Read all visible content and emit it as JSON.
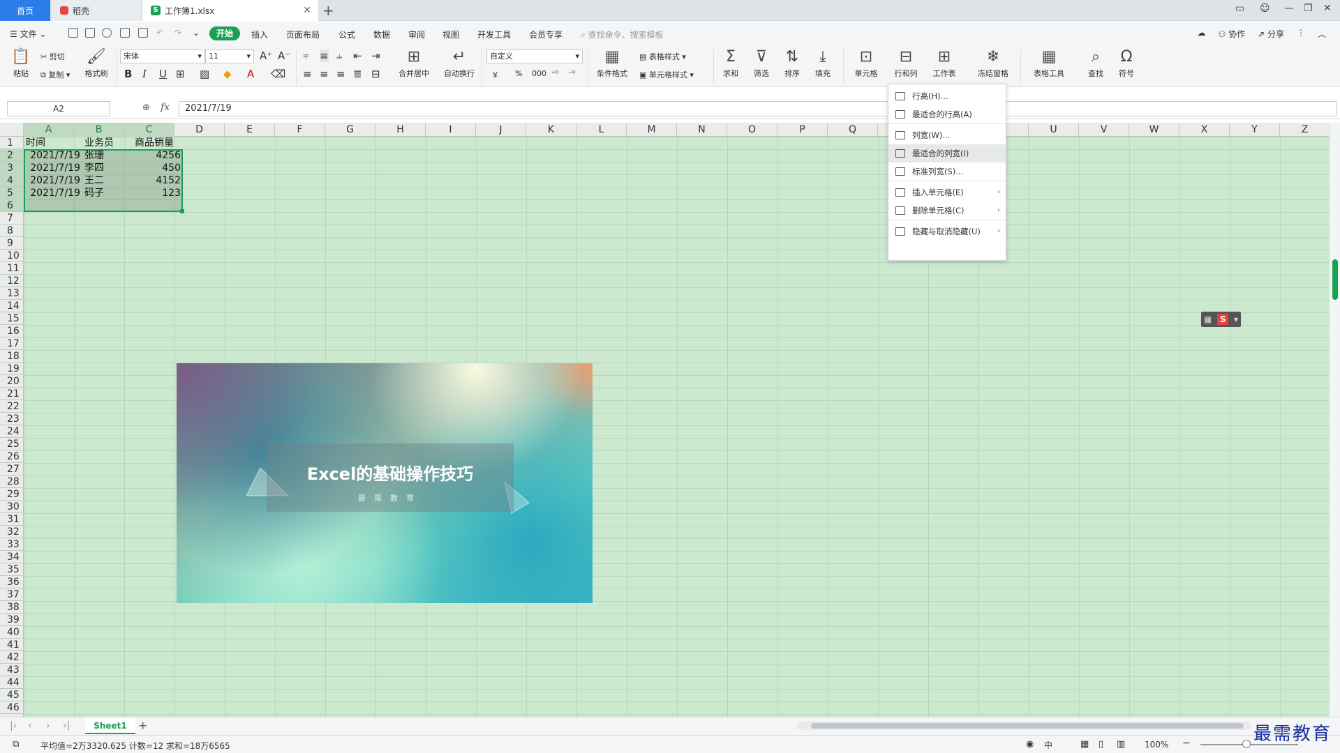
{
  "tabs": {
    "home": "首页",
    "daoke": "稻壳",
    "file": "工作簿1.xlsx"
  },
  "menubar": {
    "file": "文件",
    "start": "开始",
    "tabs": [
      "插入",
      "页面布局",
      "公式",
      "数据",
      "审阅",
      "视图",
      "开发工具",
      "会员专享"
    ],
    "search_placeholder": "查找命令、搜索模板",
    "collab": "协作",
    "share": "分享"
  },
  "ribbon": {
    "paste": "粘贴",
    "cut": "剪切",
    "copy": "复制",
    "format_painter": "格式刷",
    "font_name": "宋体",
    "font_size": "11",
    "bold": "B",
    "italic": "I",
    "underline": "U",
    "merge": "合并居中",
    "wrap": "自动换行",
    "number_format": "自定义",
    "currency": "￥",
    "percent": "%",
    "thousands": "000",
    "cond_format": "条件格式",
    "table_style": "表格样式",
    "cell_style": "单元格样式",
    "sum": "求和",
    "filter": "筛选",
    "sort": "排序",
    "fill": "填充",
    "cell": "单元格",
    "rowcol": "行和列",
    "worksheet": "工作表",
    "freeze": "冻结窗格",
    "table_tools": "表格工具",
    "find": "查找",
    "symbol": "符号"
  },
  "formula": {
    "namebox": "A2",
    "fx": "fx",
    "value": "2021/7/19"
  },
  "columns": [
    "A",
    "B",
    "C",
    "D",
    "E",
    "F",
    "G",
    "H",
    "I",
    "J",
    "K",
    "L",
    "M",
    "N",
    "O",
    "P",
    "Q",
    "R",
    "S",
    "T",
    "U",
    "V",
    "W",
    "X",
    "Y",
    "Z"
  ],
  "rows": [
    "1",
    "2",
    "3",
    "4",
    "5",
    "6",
    "7",
    "8",
    "9",
    "10",
    "11",
    "12",
    "13",
    "14",
    "15",
    "16",
    "17",
    "18",
    "19",
    "20",
    "21",
    "22",
    "23",
    "24",
    "25",
    "26",
    "27",
    "28",
    "29",
    "30",
    "31",
    "32",
    "33",
    "34",
    "35",
    "36",
    "37",
    "38",
    "39",
    "40",
    "41",
    "42",
    "43",
    "44",
    "45",
    "46"
  ],
  "sheet": {
    "headers": [
      "时间",
      "业务员",
      "商品销量"
    ],
    "data": [
      [
        "2021/7/19",
        "张珊",
        "4256"
      ],
      [
        "2021/7/19",
        "李四",
        "450"
      ],
      [
        "2021/7/19",
        "王二",
        "4152"
      ],
      [
        "2021/7/19",
        "码子",
        "123"
      ]
    ]
  },
  "banner": {
    "title": "Excel的基础操作技巧",
    "subtitle": "最需教育"
  },
  "context_menu": [
    {
      "label": "行高(H)...",
      "icon": "row-height-icon",
      "arrow": ""
    },
    {
      "label": "最适合的行高(A)",
      "icon": "autofit-row-icon",
      "arrow": ""
    },
    {
      "label": "列宽(W)...",
      "icon": "col-width-icon",
      "arrow": ""
    },
    {
      "label": "最适合的列宽(I)",
      "icon": "autofit-col-icon",
      "arrow": ""
    },
    {
      "label": "标准列宽(S)...",
      "icon": "std-width-icon",
      "arrow": ""
    },
    {
      "label": "插入单元格(E)",
      "icon": "insert-cell-icon",
      "arrow": "›"
    },
    {
      "label": "删除单元格(C)",
      "icon": "delete-cell-icon",
      "arrow": "›"
    },
    {
      "label": "隐藏与取消隐藏(U)",
      "icon": "hide-icon",
      "arrow": "›"
    }
  ],
  "sheettabs": {
    "name": "Sheet1"
  },
  "status": {
    "text": "平均值=2万3320.625  计数=12  求和=18万6565",
    "zoom": "100%"
  },
  "watermark": "最需教育",
  "colors": {
    "accent": "#1aa053",
    "tab_blue": "#2b7de9",
    "grid_bg": "#cce8cf"
  }
}
